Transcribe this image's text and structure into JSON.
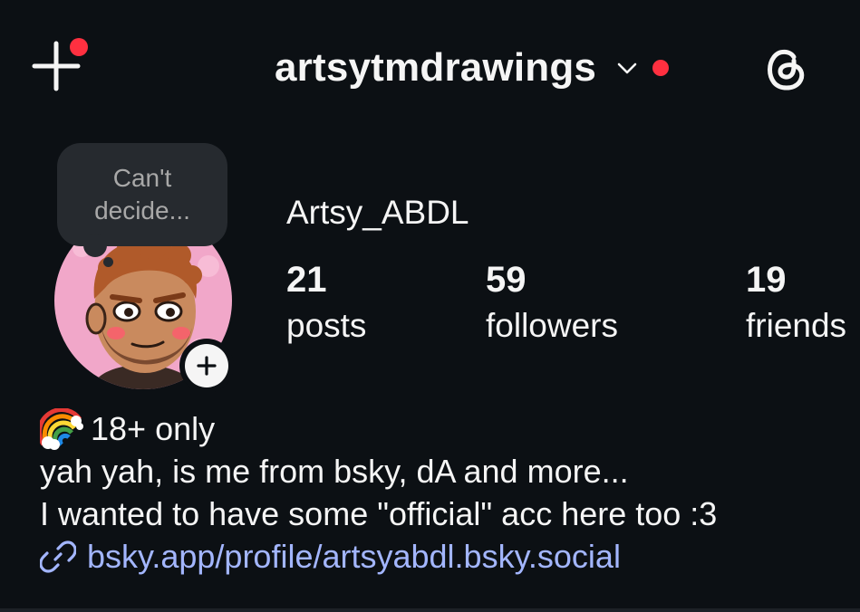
{
  "header": {
    "username": "artsytmdrawings",
    "create_icon": "plus-icon",
    "chevron_icon": "chevron-down-icon",
    "threads_icon": "threads-icon",
    "accent_color": "#ff3040"
  },
  "note": {
    "line1": "Can't",
    "line2": "decide..."
  },
  "profile": {
    "display_name": "Artsy_ABDL",
    "add_story_icon": "plus-icon",
    "stats": [
      {
        "count": "21",
        "label": "posts"
      },
      {
        "count": "59",
        "label": "followers"
      },
      {
        "count": "19",
        "label": "friends"
      }
    ]
  },
  "bio": {
    "line1_emoji": "rainbow-icon",
    "line1": "18+ only",
    "line2": "yah yah, is me from bsky, dA and more...",
    "line3": "I wanted to have some \"official\" acc here too :3",
    "link_icon": "link-icon",
    "link": "bsky.app/profile/artsyabdl.bsky.social",
    "link_color": "#a3b6ff"
  }
}
